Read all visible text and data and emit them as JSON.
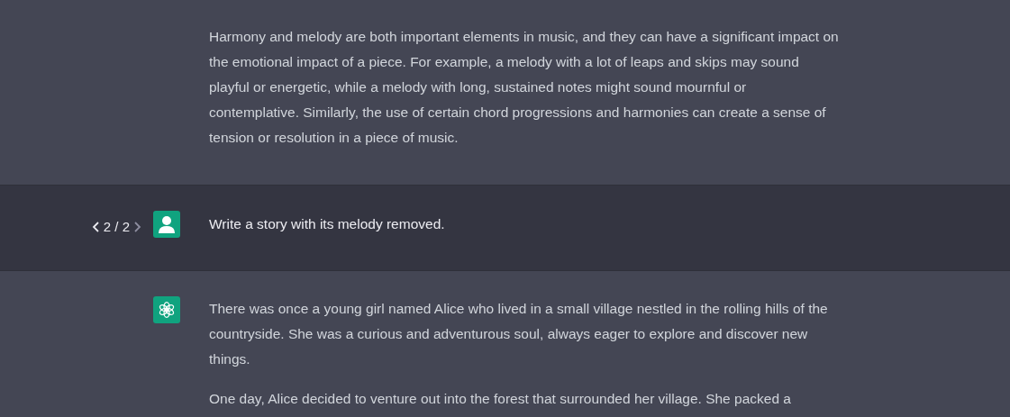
{
  "messages": [
    {
      "kind": "assistant",
      "paragraphs": [
        "Harmony and melody are both important elements in music, and they can have a significant impact on the emotional impact of a piece. For example, a melody with a lot of leaps and skips may sound playful or energetic, while a melody with long, sustained notes might sound mournful or contemplative. Similarly, the use of certain chord progressions and harmonies can create a sense of tension or resolution in a piece of music."
      ]
    },
    {
      "kind": "user",
      "pager": {
        "text": "2 / 2",
        "prev_disabled": false,
        "next_disabled": true
      },
      "paragraphs": [
        "Write a story with its melody removed."
      ]
    },
    {
      "kind": "assistant",
      "paragraphs": [
        "There was once a young girl named Alice who lived in a small village nestled in the rolling hills of the countryside. She was a curious and adventurous soul, always eager to explore and discover new things.",
        "One day, Alice decided to venture out into the forest that surrounded her village. She packed a"
      ]
    }
  ]
}
